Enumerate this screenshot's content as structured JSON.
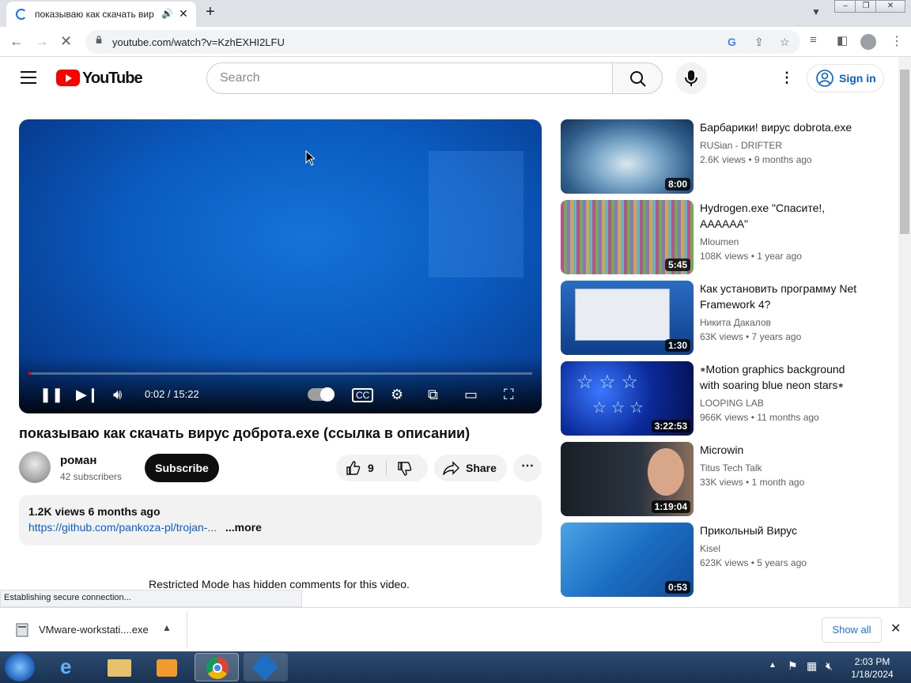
{
  "browser": {
    "tab_title": "показываю как скачать вир",
    "tab_close": "✕",
    "new_tab": "+",
    "url": "youtube.com/watch?v=KzhEXHI2LFU",
    "status": "Establishing secure connection...",
    "download_file": "VMware-workstati....exe",
    "show_all": "Show all"
  },
  "youtube": {
    "logo_text": "YouTube",
    "search_placeholder": "Search",
    "sign_in": "Sign in"
  },
  "player": {
    "time": "0:02 / 15:22",
    "progress": 0.002
  },
  "video": {
    "title": "показываю как скачать вирус доброта.exe (ссылка в описании)",
    "channel": "роман",
    "subscribers": "42 subscribers",
    "subscribe": "Subscribe",
    "likes": "9",
    "share": "Share",
    "meta": "1.2K views  6 months ago",
    "link": "https://github.com/pankoza-pl/trojan-...",
    "more": "...more",
    "comments_notice": "Restricted Mode has hidden comments for this video."
  },
  "recommendations": [
    {
      "title": "Барбарики! вирус dobrota.exe",
      "channel": "RUSian - DRIFTER",
      "meta": "2.6K views  •  9 months ago",
      "duration": "8:00"
    },
    {
      "title": "Hydrogen.exe \"Спасите!, АААААА\"",
      "channel": "Mloumen",
      "meta": "108K views  •  1 year ago",
      "duration": "5:45"
    },
    {
      "title": "Как установить программу Net Framework 4?",
      "channel": "Никита Дакалов",
      "meta": "63K views  •  7 years ago",
      "duration": "1:30"
    },
    {
      "title": "⭒Motion graphics background with soaring blue neon stars⭒",
      "channel": "LOOPING LAB",
      "meta": "966K views  •  11 months ago",
      "duration": "3:22:53"
    },
    {
      "title": "Microwin",
      "channel": "Titus Tech Talk",
      "meta": "33K views  •  1 month ago",
      "duration": "1:19:04"
    },
    {
      "title": "Прикольный Вирус",
      "channel": "Kisel",
      "meta": "623K views  •  5 years ago",
      "duration": "0:53"
    }
  ],
  "taskbar": {
    "time": "2:03 PM",
    "date": "1/18/2024"
  }
}
